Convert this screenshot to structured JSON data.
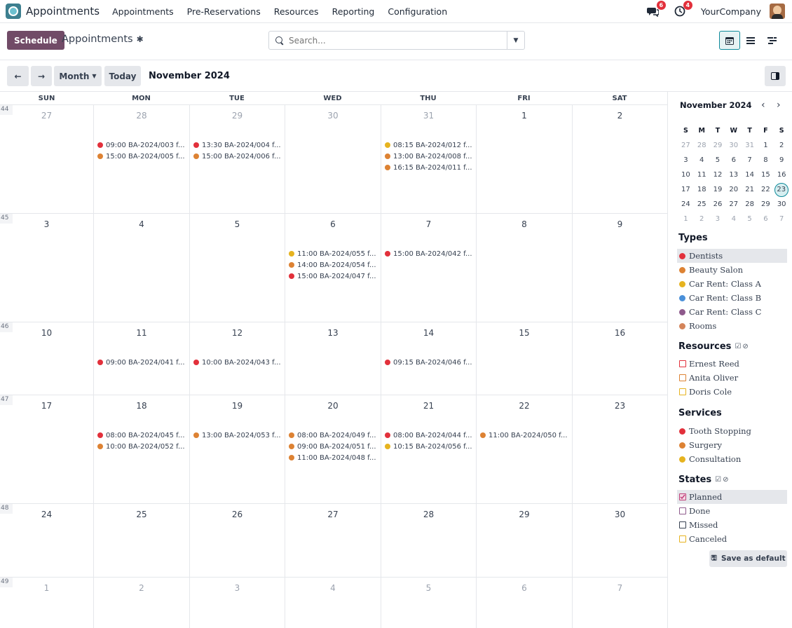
{
  "topnav": {
    "app_name": "Appointments",
    "menu": [
      "Appointments",
      "Pre-Reservations",
      "Resources",
      "Reporting",
      "Configuration"
    ],
    "messages_badge": "6",
    "activity_badge": "4",
    "company": "YourCompany"
  },
  "control": {
    "schedule_label": "Schedule",
    "breadcrumb": "Appointments",
    "search_placeholder": "Search..."
  },
  "toolbar": {
    "scale": "Month",
    "today": "Today",
    "title": "November 2024"
  },
  "calendar": {
    "days_of_week": [
      "SUN",
      "MON",
      "TUE",
      "WED",
      "THU",
      "FRI",
      "SAT"
    ],
    "weeks": [
      {
        "num": "44",
        "days": [
          {
            "d": "27",
            "other": true,
            "events": []
          },
          {
            "d": "28",
            "other": true,
            "events": [
              {
                "label": "09:00 BA-2024/003 f...",
                "color": "#e2303b"
              },
              {
                "label": "15:00 BA-2024/005 f...",
                "color": "#dd8233"
              }
            ]
          },
          {
            "d": "29",
            "other": true,
            "events": [
              {
                "label": "13:30 BA-2024/004 f...",
                "color": "#e2303b"
              },
              {
                "label": "15:00 BA-2024/006 f...",
                "color": "#dd8233"
              }
            ]
          },
          {
            "d": "30",
            "other": true,
            "events": []
          },
          {
            "d": "31",
            "other": true,
            "events": [
              {
                "label": "08:15 BA-2024/012 f...",
                "color": "#e6b31f"
              },
              {
                "label": "13:00 BA-2024/008 f...",
                "color": "#dd8233"
              },
              {
                "label": "16:15 BA-2024/011 f...",
                "color": "#dd8233"
              }
            ]
          },
          {
            "d": "1",
            "other": false,
            "events": []
          },
          {
            "d": "2",
            "other": false,
            "events": []
          }
        ]
      },
      {
        "num": "45",
        "days": [
          {
            "d": "3",
            "other": false,
            "events": []
          },
          {
            "d": "4",
            "other": false,
            "events": []
          },
          {
            "d": "5",
            "other": false,
            "events": []
          },
          {
            "d": "6",
            "other": false,
            "events": [
              {
                "label": "11:00 BA-2024/055 f...",
                "color": "#e6b31f"
              },
              {
                "label": "14:00 BA-2024/054 f...",
                "color": "#dd8233"
              },
              {
                "label": "15:00 BA-2024/047 f...",
                "color": "#e2303b"
              }
            ]
          },
          {
            "d": "7",
            "other": false,
            "events": [
              {
                "label": "15:00 BA-2024/042 f...",
                "color": "#e2303b"
              }
            ]
          },
          {
            "d": "8",
            "other": false,
            "events": []
          },
          {
            "d": "9",
            "other": false,
            "events": []
          }
        ]
      },
      {
        "num": "46",
        "days": [
          {
            "d": "10",
            "other": false,
            "events": []
          },
          {
            "d": "11",
            "other": false,
            "events": [
              {
                "label": "09:00 BA-2024/041 f...",
                "color": "#e2303b"
              }
            ]
          },
          {
            "d": "12",
            "other": false,
            "events": [
              {
                "label": "10:00 BA-2024/043 f...",
                "color": "#e2303b"
              }
            ]
          },
          {
            "d": "13",
            "other": false,
            "events": []
          },
          {
            "d": "14",
            "other": false,
            "events": [
              {
                "label": "09:15 BA-2024/046 f...",
                "color": "#e2303b"
              }
            ]
          },
          {
            "d": "15",
            "other": false,
            "events": []
          },
          {
            "d": "16",
            "other": false,
            "events": []
          }
        ]
      },
      {
        "num": "47",
        "days": [
          {
            "d": "17",
            "other": false,
            "events": []
          },
          {
            "d": "18",
            "other": false,
            "events": [
              {
                "label": "08:00 BA-2024/045 f...",
                "color": "#e2303b"
              },
              {
                "label": "10:00 BA-2024/052 f...",
                "color": "#dd8233"
              }
            ]
          },
          {
            "d": "19",
            "other": false,
            "events": [
              {
                "label": "13:00 BA-2024/053 f...",
                "color": "#dd8233"
              }
            ]
          },
          {
            "d": "20",
            "other": false,
            "events": [
              {
                "label": "08:00 BA-2024/049 f...",
                "color": "#dd8233"
              },
              {
                "label": "09:00 BA-2024/051 f...",
                "color": "#dd8233"
              },
              {
                "label": "11:00 BA-2024/048 f...",
                "color": "#dd8233"
              }
            ]
          },
          {
            "d": "21",
            "other": false,
            "events": [
              {
                "label": "08:00 BA-2024/044 f...",
                "color": "#e2303b"
              },
              {
                "label": "10:15 BA-2024/056 f...",
                "color": "#e6b31f"
              }
            ]
          },
          {
            "d": "22",
            "other": false,
            "events": [
              {
                "label": "11:00 BA-2024/050 f...",
                "color": "#dd8233"
              }
            ]
          },
          {
            "d": "23",
            "other": false,
            "events": []
          }
        ]
      },
      {
        "num": "48",
        "days": [
          {
            "d": "24",
            "other": false,
            "events": []
          },
          {
            "d": "25",
            "other": false,
            "events": []
          },
          {
            "d": "26",
            "other": false,
            "events": []
          },
          {
            "d": "27",
            "other": false,
            "events": []
          },
          {
            "d": "28",
            "other": false,
            "events": []
          },
          {
            "d": "29",
            "other": false,
            "events": []
          },
          {
            "d": "30",
            "other": false,
            "events": []
          }
        ]
      },
      {
        "num": "49",
        "days": [
          {
            "d": "1",
            "other": true,
            "events": []
          },
          {
            "d": "2",
            "other": true,
            "events": []
          },
          {
            "d": "3",
            "other": true,
            "events": []
          },
          {
            "d": "4",
            "other": true,
            "events": []
          },
          {
            "d": "5",
            "other": true,
            "events": []
          },
          {
            "d": "6",
            "other": true,
            "events": []
          },
          {
            "d": "7",
            "other": true,
            "events": []
          }
        ]
      }
    ]
  },
  "sidebar": {
    "mini_title": "November 2024",
    "mini_dow": [
      "S",
      "M",
      "T",
      "W",
      "T",
      "F",
      "S"
    ],
    "mini_weeks": [
      [
        {
          "d": "27",
          "o": true
        },
        {
          "d": "28",
          "o": true
        },
        {
          "d": "29",
          "o": true
        },
        {
          "d": "30",
          "o": true
        },
        {
          "d": "31",
          "o": true
        },
        {
          "d": "1"
        },
        {
          "d": "2"
        }
      ],
      [
        {
          "d": "3"
        },
        {
          "d": "4"
        },
        {
          "d": "5"
        },
        {
          "d": "6"
        },
        {
          "d": "7"
        },
        {
          "d": "8"
        },
        {
          "d": "9"
        }
      ],
      [
        {
          "d": "10"
        },
        {
          "d": "11"
        },
        {
          "d": "12"
        },
        {
          "d": "13"
        },
        {
          "d": "14"
        },
        {
          "d": "15"
        },
        {
          "d": "16"
        }
      ],
      [
        {
          "d": "17"
        },
        {
          "d": "18"
        },
        {
          "d": "19"
        },
        {
          "d": "20"
        },
        {
          "d": "21"
        },
        {
          "d": "22"
        },
        {
          "d": "23",
          "today": true
        }
      ],
      [
        {
          "d": "24"
        },
        {
          "d": "25"
        },
        {
          "d": "26"
        },
        {
          "d": "27"
        },
        {
          "d": "28"
        },
        {
          "d": "29"
        },
        {
          "d": "30"
        }
      ],
      [
        {
          "d": "1",
          "o": true
        },
        {
          "d": "2",
          "o": true
        },
        {
          "d": "3",
          "o": true
        },
        {
          "d": "4",
          "o": true
        },
        {
          "d": "5",
          "o": true
        },
        {
          "d": "6",
          "o": true
        },
        {
          "d": "7",
          "o": true
        }
      ]
    ],
    "types_title": "Types",
    "types": [
      {
        "label": "Dentists",
        "color": "#e2303b",
        "highlight": true
      },
      {
        "label": "Beauty Salon",
        "color": "#dd8233"
      },
      {
        "label": "Car Rent: Class A",
        "color": "#e6b31f"
      },
      {
        "label": "Car Rent: Class B",
        "color": "#4a90d9"
      },
      {
        "label": "Car Rent: Class C",
        "color": "#8e5a8c"
      },
      {
        "label": "Rooms",
        "color": "#d4845a"
      }
    ],
    "resources_title": "Resources",
    "resources": [
      {
        "label": "Ernest Reed",
        "color": "#e2303b"
      },
      {
        "label": "Anita Oliver",
        "color": "#dd8233"
      },
      {
        "label": "Doris Cole",
        "color": "#e6b31f"
      }
    ],
    "services_title": "Services",
    "services": [
      {
        "label": "Tooth Stopping",
        "color": "#e2303b"
      },
      {
        "label": "Surgery",
        "color": "#dd8233"
      },
      {
        "label": "Consultation",
        "color": "#e6b31f"
      }
    ],
    "states_title": "States",
    "states": [
      {
        "label": "Planned",
        "color": "#c0407a",
        "checked": true,
        "highlight": true
      },
      {
        "label": "Done",
        "color": "#8e5a8c"
      },
      {
        "label": "Missed",
        "color": "#374151"
      },
      {
        "label": "Canceled",
        "color": "#e6b31f"
      }
    ],
    "save_default": "Save as default"
  }
}
